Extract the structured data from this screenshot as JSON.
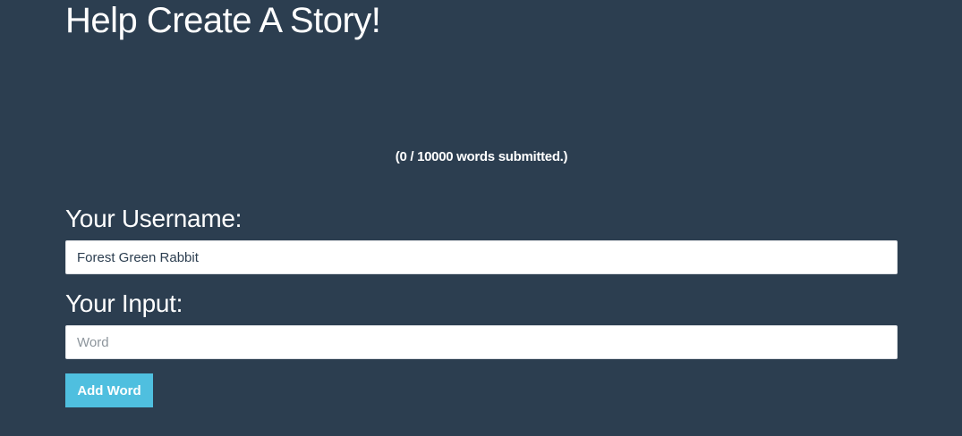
{
  "header": {
    "title": "Help Create A Story!"
  },
  "story": {
    "count_text": "(0 / 10000 words submitted.)"
  },
  "form": {
    "username_label": "Your Username:",
    "username_value": "Forest Green Rabbit",
    "input_label": "Your Input:",
    "input_value": "",
    "input_placeholder": "Word",
    "submit_label": "Add Word"
  },
  "colors": {
    "background": "#2c3e50",
    "button": "#4fbfdf",
    "text": "#ffffff"
  }
}
